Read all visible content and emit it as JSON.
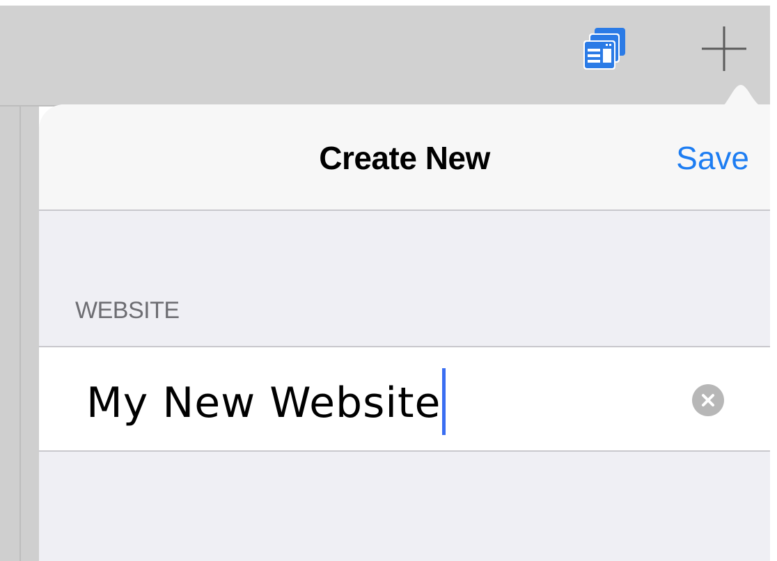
{
  "toolbar": {
    "pages_icon": "pages-icon",
    "add_icon": "plus-icon"
  },
  "popover": {
    "title": "Create New",
    "save_label": "Save",
    "section_header": "WEBSITE",
    "field_value": "My New Website",
    "clear_icon": "clear-x-icon"
  },
  "colors": {
    "accent": "#1d7df2",
    "caret": "#3a6ef2",
    "toolbar_bg": "#d1d1d1",
    "grouped_bg": "#efeff4"
  }
}
